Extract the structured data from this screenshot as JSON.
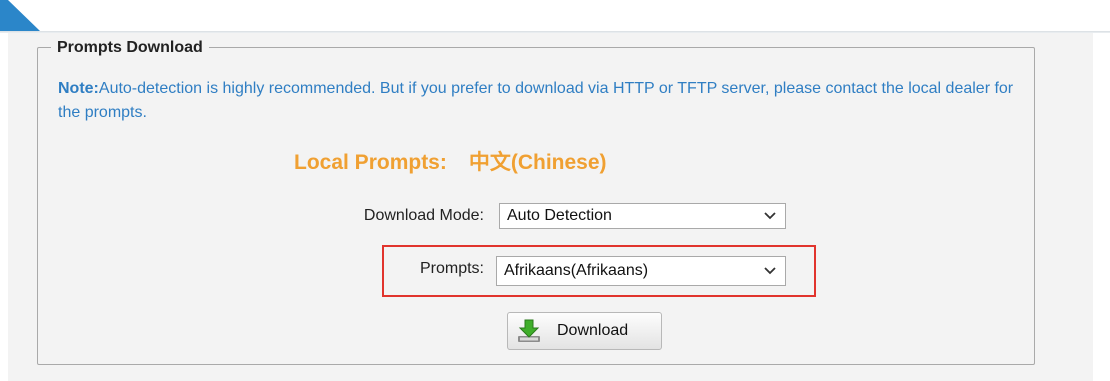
{
  "section": {
    "title": "Prompts Download",
    "note_label": "Note:",
    "note_text": "Auto-detection is highly recommended. But if you prefer to download via HTTP or TFTP server, please contact the local dealer for the prompts."
  },
  "local_prompts": {
    "label": "Local Prompts:",
    "value": "中文(Chinese)"
  },
  "download_mode": {
    "label": "Download Mode:",
    "selected": "Auto Detection"
  },
  "prompts": {
    "label": "Prompts:",
    "selected": "Afrikaans(Afrikaans)"
  },
  "download_button": {
    "label": "Download"
  },
  "colors": {
    "accent_blue": "#2f7ec3",
    "local_orange": "#f0a032",
    "highlight_red": "#e1342d",
    "panel_bg": "#f3f3f3"
  },
  "icons": {
    "download": "download-arrow-icon",
    "dropdown": "chevron-down-icon"
  }
}
